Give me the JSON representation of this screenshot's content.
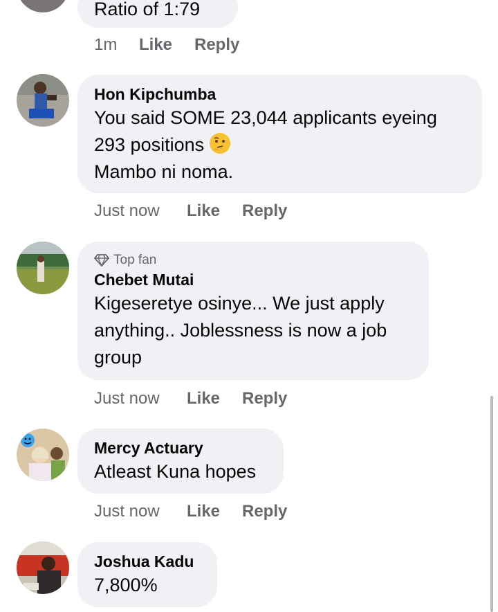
{
  "comments": [
    {
      "text": "Ratio of 1:79",
      "time": "1m",
      "like": "Like",
      "reply": "Reply"
    },
    {
      "author": "Hon Kipchumba",
      "lines": [
        "You said SOME 23,044 applicants eyeing",
        "293 positions",
        "Mambo ni noma."
      ],
      "emoji": "thinking-face-emoji",
      "time": "Just now",
      "like": "Like",
      "reply": "Reply"
    },
    {
      "badge": "Top fan",
      "author": "Chebet Mutai",
      "lines": [
        "Kigeseretye osinye... We just apply",
        "anything.. Joblessness is now a job",
        "group"
      ],
      "time": "Just now",
      "like": "Like",
      "reply": "Reply"
    },
    {
      "author": "Mercy Actuary",
      "lines": [
        "Atleast Kuna hopes"
      ],
      "time": "Just now",
      "like": "Like",
      "reply": "Reply"
    },
    {
      "author": "Joshua Kadu",
      "lines": [
        "7,800%"
      ]
    }
  ],
  "colors": {
    "bubble": "#eff1f4",
    "meta": "#65676b",
    "text": "#050505"
  }
}
